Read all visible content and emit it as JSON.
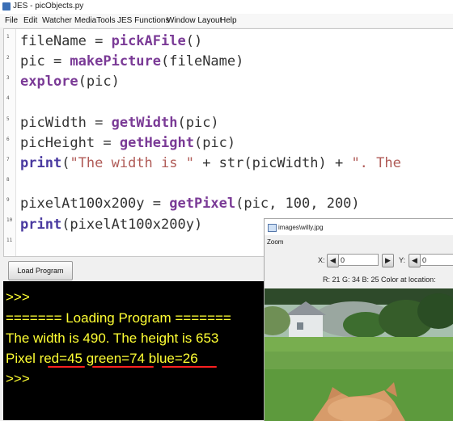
{
  "window": {
    "title": "JES - picObjects.py"
  },
  "menu": [
    "File",
    "Edit",
    "Watcher",
    "MediaTools",
    "JES Functions",
    "Window Layout",
    "Help"
  ],
  "editor": {
    "line_numbers": [
      "1",
      "2",
      "3",
      "4",
      "5",
      "6",
      "7",
      "8",
      "9",
      "10",
      "11"
    ],
    "lines": {
      "l1a": "fileName = ",
      "l1b": "pickAFile",
      "l1c": "()",
      "l2a": "pic = ",
      "l2b": "makePicture",
      "l2c": "(fileName)",
      "l3a": "explore",
      "l3b": "(pic)",
      "l5a": "picWidth = ",
      "l5b": "getWidth",
      "l5c": "(pic)",
      "l6a": "picHeight = ",
      "l6b": "getHeight",
      "l6c": "(pic)",
      "l7a": "print",
      "l7b": "(",
      "l7c": "\"The width is \"",
      "l7d": " + str(picWidth) + ",
      "l7e": "\". The",
      "l9a": "pixelAt100x200y = ",
      "l9b": "getPixel",
      "l9c": "(pic, 100, 200)",
      "l10a": "print",
      "l10b": "(pixelAt100x200y)"
    }
  },
  "load_button": {
    "label": "Load Program"
  },
  "console": {
    "lines": [
      ">>>",
      "======= Loading Program =======",
      "The width is 490. The height is 653",
      "Pixel red=45 green=74 blue=26",
      ">>>"
    ],
    "highlights": [
      "red=45",
      "green=74",
      "blue=26"
    ],
    "highlight_color": "#ff2020",
    "text_color": "#ffff33",
    "background": "#000000"
  },
  "picture_tool": {
    "title": "images\\willy.jpg",
    "zoom_menu": "Zoom",
    "x_label": "X:",
    "x_value": "0",
    "y_label": "Y:",
    "y_value": "0",
    "pixel_info": "R: 21 G: 34 B: 25 Color at location:"
  }
}
